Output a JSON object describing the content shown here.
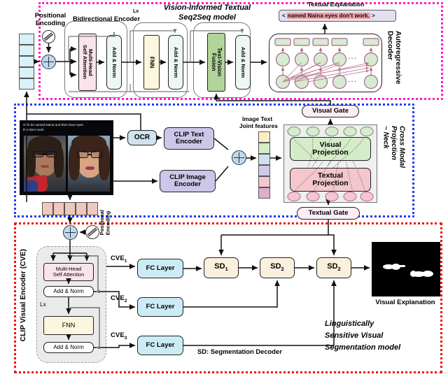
{
  "figure": {
    "type": "architecture-diagram",
    "title_top_right": "Vision-Informed Textual\nSeq2Seq model"
  },
  "top_section": {
    "frame_color": "#ff1fbf",
    "title_line1": "Vision-Informed Textual",
    "title_line2": "Seq2Seq model",
    "positional_encoding_label": "Positional\nEncoding",
    "positional_encoding_line1": "Positional",
    "positional_encoding_line2": "Encoding",
    "bidirectional_encoder_label": "Bidirectional Encoder",
    "lx_label": "Lx",
    "blocks": [
      {
        "label": "Multi-Head\nSelf Attention",
        "color": "#fbe3ec"
      },
      {
        "label": "Add & Norm",
        "color": "#eef7f4"
      },
      {
        "label": "FNN",
        "color": "#fbf6dd"
      },
      {
        "label": "Add & Norm",
        "color": "#eef7f4"
      },
      {
        "label": "Text-Vision\nFusion",
        "color": "#b2d49a"
      },
      {
        "label": "Add & Norm",
        "color": "#eef7f4"
      }
    ],
    "multi_head_l1": "Multi-Head",
    "multi_head_l2": "Self Attention",
    "add_norm_label": "Add & Norm",
    "fnn_label": "FNN",
    "fusion_l1": "Text-Vision",
    "fusion_l2": "Fusion",
    "textual_explanation_caption": "Textual Explanation",
    "explanation_open": "<",
    "explanation_highlight": "named Naina eyes don't work.",
    "explanation_close": ">",
    "decoder_label_l1": "Autoregressive",
    "decoder_label_l2": "Decoder",
    "decoder_ellipsis": ". . . .",
    "input_token_color": "#d9f1f8"
  },
  "middle_section": {
    "frame_color": "#1f3df5",
    "meme_caption": "Girls be named Naina and then have eyes that don't work",
    "meme_caption_l1": "Girls be named Naina and then have eyes",
    "meme_caption_l2": "that don't work",
    "ocr_label": "OCR",
    "ocr_color": "#cfe3ef",
    "clip_text_encoder_l1": "CLIP Text",
    "clip_text_encoder_l2": "Encoder",
    "clip_image_encoder_l1": "CLIP Image",
    "clip_image_encoder_l2": "Encoder",
    "clip_box_color": "#ccc6e8",
    "joint_features_l1": "Image Text",
    "joint_features_l2": "Joint features",
    "joint_feature_colors": [
      "#fbefc0",
      "#d5ecc8",
      "#cfe0f5",
      "#cfc9ea",
      "#f3c7cd",
      "#ddaecb"
    ],
    "visual_gate_label": "Visual Gate",
    "textual_gate_label": "Textual Gate",
    "visual_gate_color": "#fdeef5",
    "textual_gate_color": "#fdeef5",
    "visual_projection_l1": "Visual",
    "visual_projection_l2": "Projection",
    "visual_projection_color": "#d5ecc8",
    "textual_projection_l1": "Textual",
    "textual_projection_l2": "Projection",
    "textual_projection_color": "#f3c7cd",
    "neck_label_l1": "Cross Modal",
    "neck_label_l2": "Projection",
    "neck_label_l3": "~ Neck",
    "image_token_color": "#f0c7bd"
  },
  "bottom_section": {
    "frame_color": "#ef1010",
    "cve_title": "CLIP Visual Encoder (CVE)",
    "positional_encoding_label": "Positional\nEncoding",
    "positional_encoding_l1": "Positional",
    "positional_encoding_l2": "Encoding",
    "lx_label": "Lx",
    "multi_head_l1": "Multi-Head",
    "multi_head_l2": "Self Attention",
    "multi_head_color": "#fbe3ec",
    "add_norm_label": "Add & Norm",
    "fnn_label": "FNN",
    "fnn_color": "#fbf6dd",
    "cve_taps": [
      "CVE",
      "CVE",
      "CVE"
    ],
    "cve_tap_labels": [
      "CVE1",
      "CVE2",
      "CVE3"
    ],
    "cve_sub": [
      "1",
      "2",
      "3"
    ],
    "fc_layer_label": "FC Layer",
    "fc_layer_color": "#ccecf5",
    "sd_blocks": [
      {
        "name": "SD",
        "sub": "1"
      },
      {
        "name": "SD",
        "sub": "2"
      },
      {
        "name": "SD",
        "sub": "2"
      }
    ],
    "sd_color": "#fbf0dd",
    "sd_legend": "SD: Segmentation Decoder",
    "visual_explanation_caption": "Visual Explanation",
    "model_title_l1": "Linguistically",
    "model_title_l2": "Sensitive Visual",
    "model_title_l3": "Segmentation model"
  }
}
